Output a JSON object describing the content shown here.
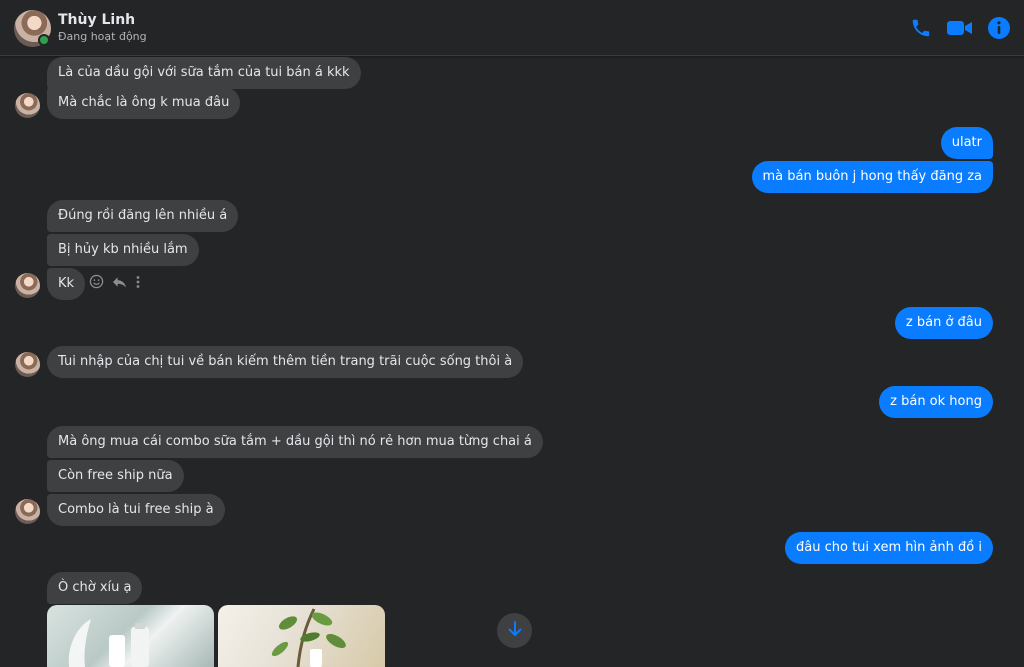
{
  "header": {
    "name": "Thùy Linh",
    "status": "Đang hoạt động",
    "accent": "#0a7cff"
  },
  "messages": {
    "m1": "Là của dầu gội với sữa tắm của tui bán á kkk",
    "m2": "Mà chắc là ông k mua đâu",
    "m3": "ulatr",
    "m4": "mà bán buôn j hong thấy đăng za",
    "m5": "Đúng rồi đăng lên nhiều á",
    "m6": "Bị hủy kb nhiều lắm",
    "m7": "Kk",
    "m8": "z bán ở đâu",
    "m9": "Tui nhập của chị tui về bán kiếm thêm tiền trang trãi cuộc sống thôi à",
    "m10": "z bán ok hong",
    "m11": "Mà ông mua cái combo sữa tắm + dầu gội thì nó rẻ hơn mua từng chai á",
    "m12": "Còn free ship nữa",
    "m13": "Combo là tui free ship à",
    "m14": "đâu cho tui xem hìn ảnh đồ i",
    "m15": "Ò chờ xíu ạ"
  },
  "icons": {
    "phone": "phone-icon",
    "video": "video-camera-icon",
    "info": "info-icon",
    "react": "smiley-icon",
    "reply": "reply-icon",
    "more": "more-vertical-icon",
    "scroll": "arrow-down-icon"
  },
  "colors": {
    "background": "#242526",
    "incoming_bubble": "#3e4042",
    "outgoing_bubble": "#0a7cff",
    "online": "#31a24c"
  }
}
